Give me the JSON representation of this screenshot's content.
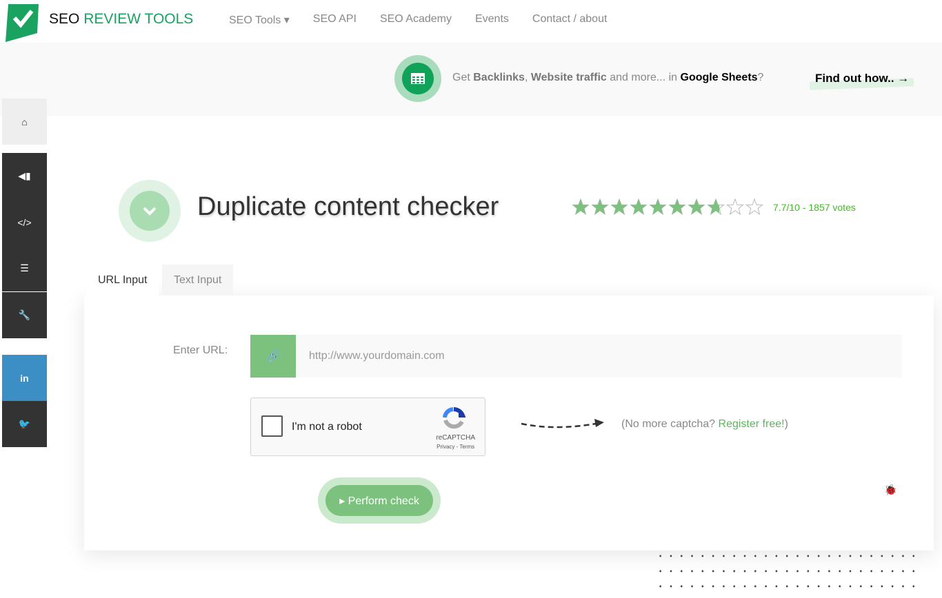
{
  "brand": {
    "part1": "SEO",
    "part2": "REVIEW TOOLS"
  },
  "nav": [
    "SEO Tools ▾",
    "SEO API",
    "SEO Academy",
    "Events",
    "Contact / about"
  ],
  "promo": {
    "get": "Get ",
    "backlinks": "Backlinks",
    "comma": ", ",
    "traffic": "Website traffic",
    "more": " and more... in ",
    "sheets": "Google Sheets",
    "q": "?",
    "cta": "Find out how.. →"
  },
  "sidebar": [
    {
      "icon": "home-icon",
      "glyph": "⌂"
    },
    {
      "icon": "megaphone-icon",
      "glyph": "📢"
    },
    {
      "icon": "code-icon",
      "glyph": "</>"
    },
    {
      "icon": "align-left-icon",
      "glyph": "≡"
    },
    {
      "icon": "wrench-icon",
      "glyph": "🔧"
    },
    {
      "icon": "linkedin-icon",
      "glyph": "in"
    },
    {
      "icon": "twitter-icon",
      "glyph": "🐦"
    }
  ],
  "title": "Duplicate content checker",
  "rating": {
    "value": 7.7,
    "max": 10,
    "text": "7.7/10 - 1857 votes"
  },
  "tabs": {
    "url": "URL Input",
    "text": "Text Input"
  },
  "form": {
    "label": "Enter URL:",
    "placeholder": "http://www.yourdomain.com",
    "robot": "I'm not a robot",
    "recaptcha": "reCAPTCHA",
    "privacy": "Privacy - Terms",
    "nocap_pre": "(No more captcha? ",
    "register": "Register free!",
    "nocap_post": ")",
    "submit": "Perform check"
  },
  "colors": {
    "accent": "#7cc27e",
    "brand": "#1aa260",
    "dark": "#333333",
    "linkedin": "#3b8fc5"
  }
}
